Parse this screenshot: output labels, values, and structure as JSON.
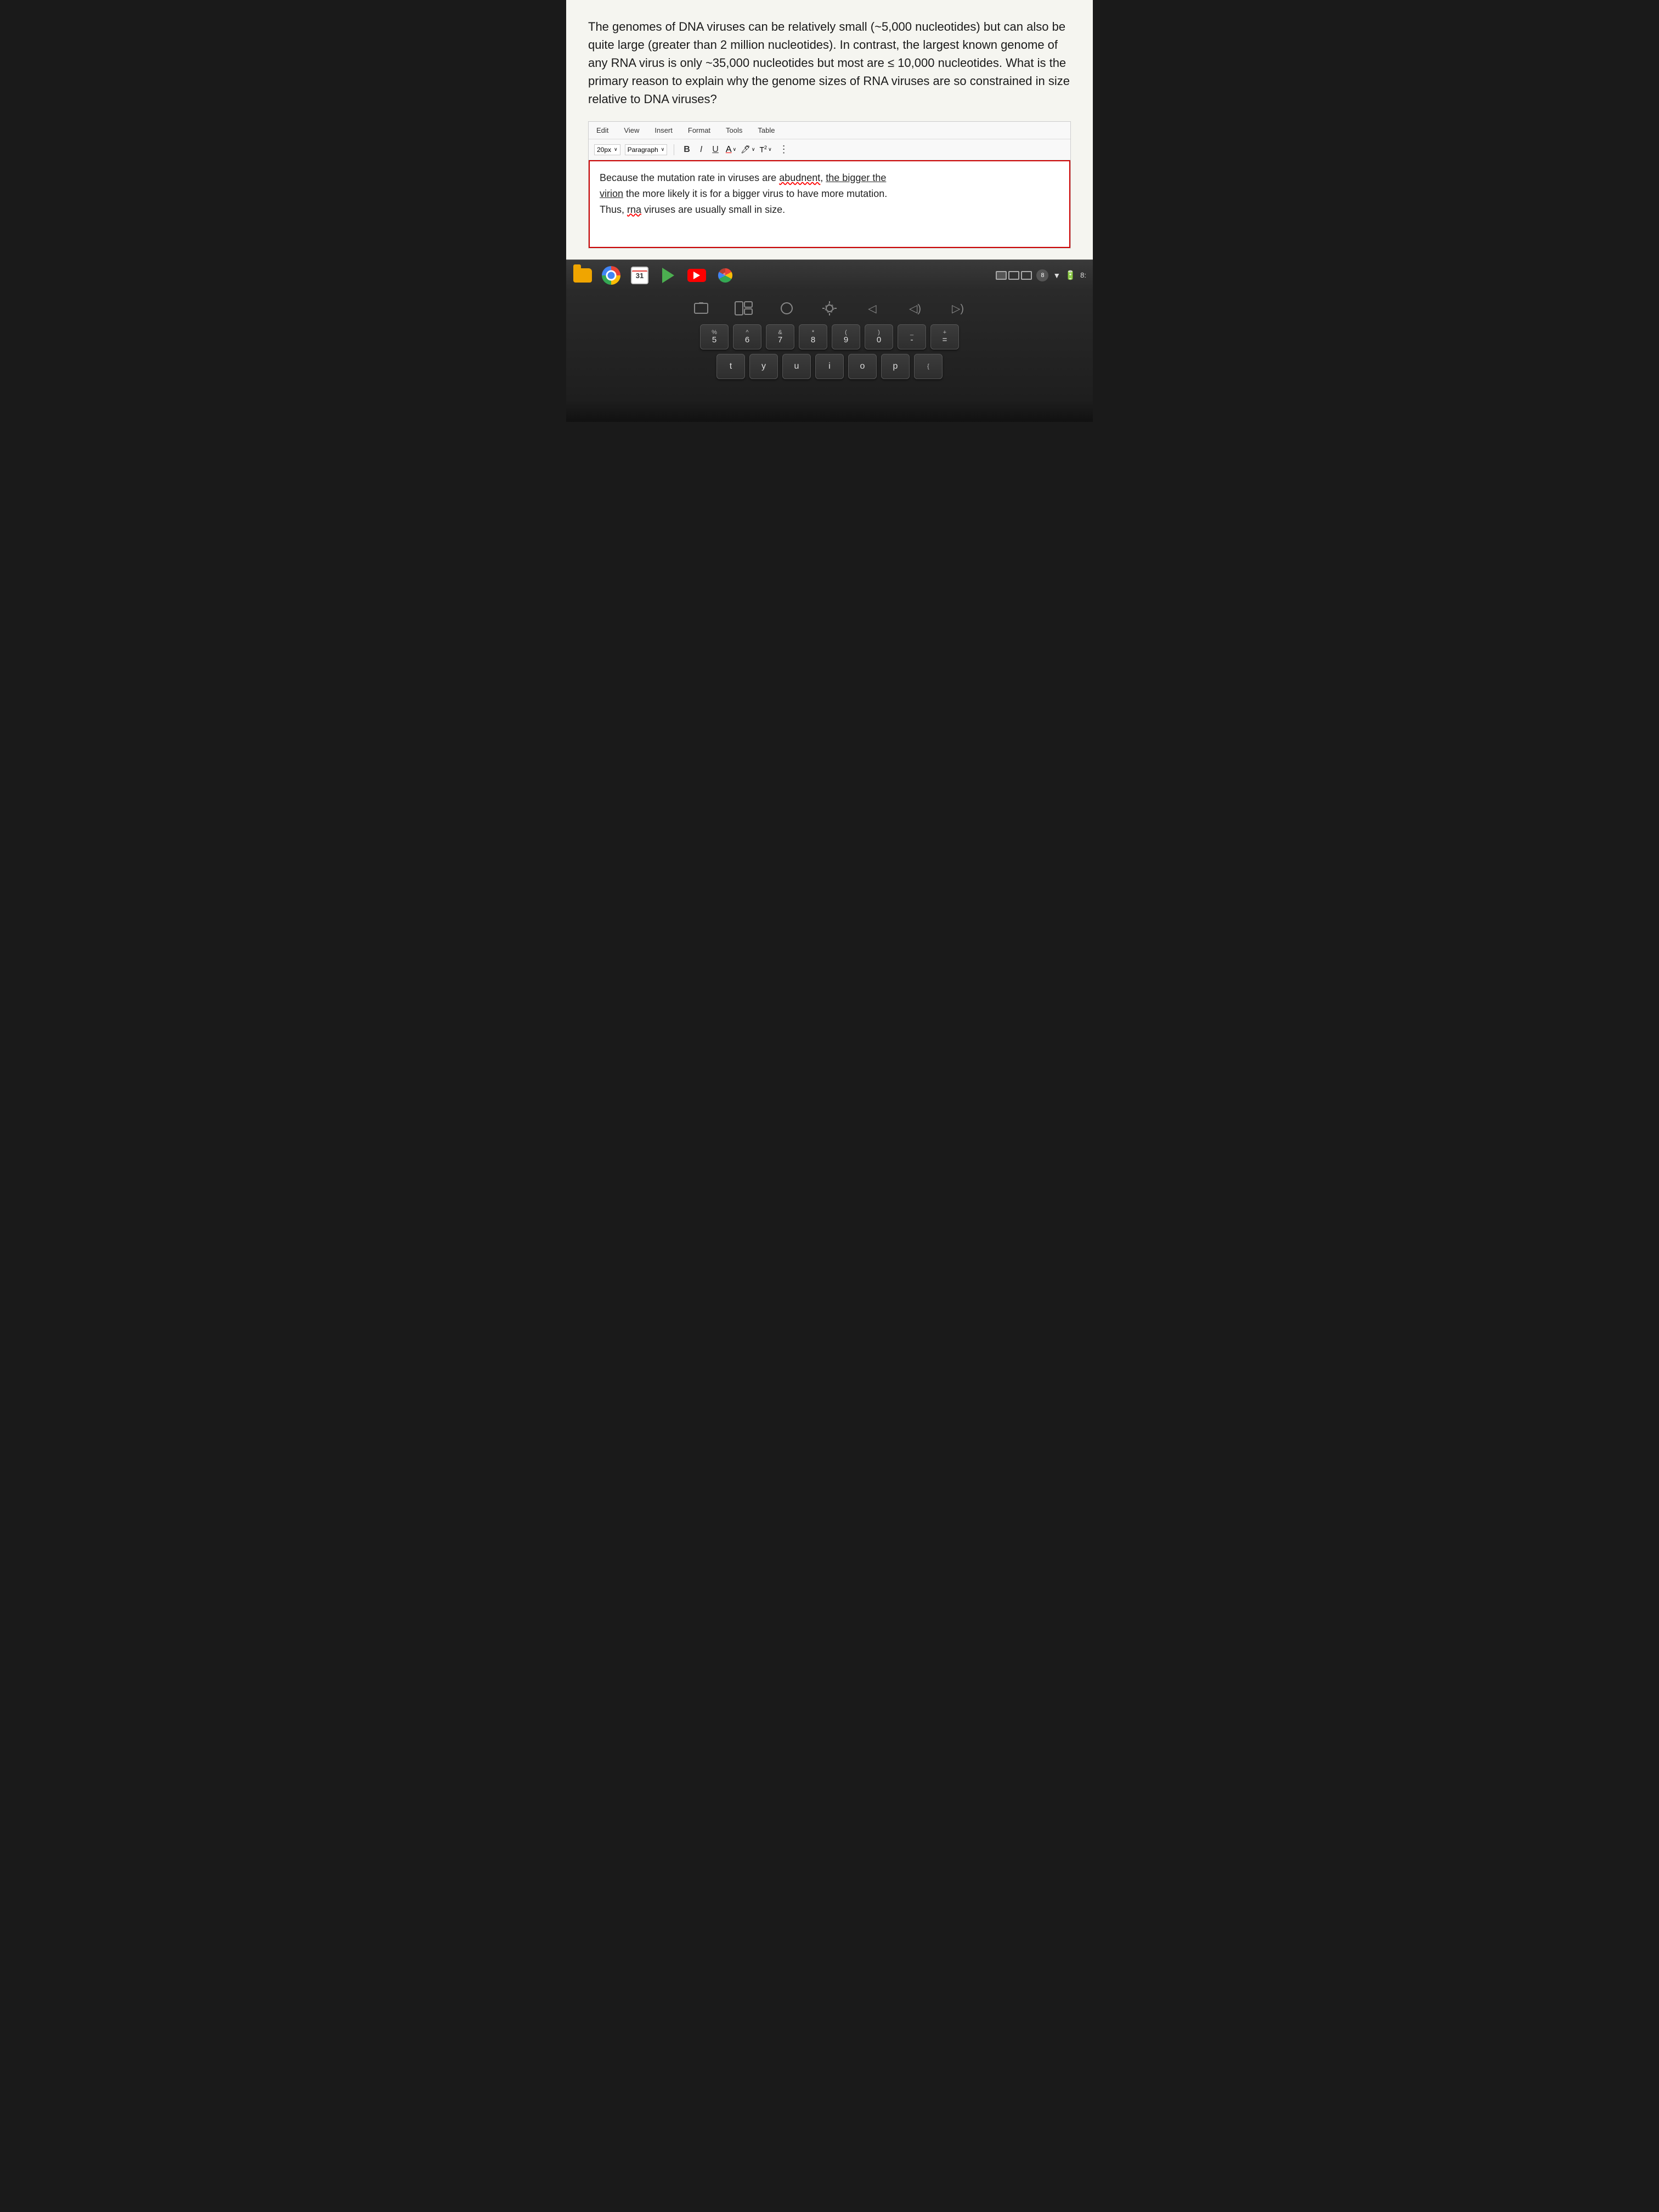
{
  "question": {
    "text": "The genomes of DNA viruses can be relatively small (~5,000 nucleotides) but can also be quite large (greater than 2 million nucleotides). In contrast, the largest known genome of any RNA virus is only ~35,000 nucleotides but most are ≤ 10,000 nucleotides. What is the primary reason to explain why the genome sizes of RNA viruses are so constrained in size relative to DNA viruses?"
  },
  "menu": {
    "items": [
      "Edit",
      "View",
      "Insert",
      "Format",
      "Tools",
      "Table"
    ]
  },
  "toolbar": {
    "font_size": "20px",
    "font_size_chevron": "∨",
    "paragraph": "Paragraph",
    "paragraph_chevron": "∨",
    "bold": "B",
    "italic": "I",
    "underline": "U",
    "font_color": "A",
    "highlight": "🖊",
    "superscript": "T²",
    "more": "⋮"
  },
  "editor": {
    "content_line1": "Because the mutation rate in viruses are abudnent, the bigger the",
    "content_line2": "virion the more likely it is for a bigger virus to have more mutation.",
    "content_line3": "Thus, rna viruses are usually small in size."
  },
  "taskbar": {
    "icons": [
      "folder",
      "chrome",
      "calendar",
      "play",
      "youtube",
      "photos"
    ],
    "calendar_date": "31",
    "time": "8:",
    "battery_icon": "🔋",
    "wifi_icon": "▼",
    "notification_num": "8"
  },
  "keyboard": {
    "row1_labels": [
      "□",
      "□II",
      "○",
      "◎",
      "◁",
      "◁)",
      "▷)"
    ],
    "row2": [
      {
        "top": "%",
        "bottom": "5"
      },
      {
        "top": "^",
        "bottom": "6"
      },
      {
        "top": "&",
        "bottom": "7"
      },
      {
        "top": "*",
        "bottom": "8"
      },
      {
        "top": "(",
        "bottom": "9"
      },
      {
        "top": ")",
        "bottom": "0"
      },
      {
        "top": "_",
        "bottom": "-"
      },
      {
        "top": "+",
        "bottom": "="
      }
    ],
    "row3": [
      {
        "single": "t"
      },
      {
        "single": "y"
      },
      {
        "single": "u"
      },
      {
        "single": "i"
      },
      {
        "single": "o"
      },
      {
        "single": "p"
      },
      {
        "single": "{"
      }
    ]
  }
}
